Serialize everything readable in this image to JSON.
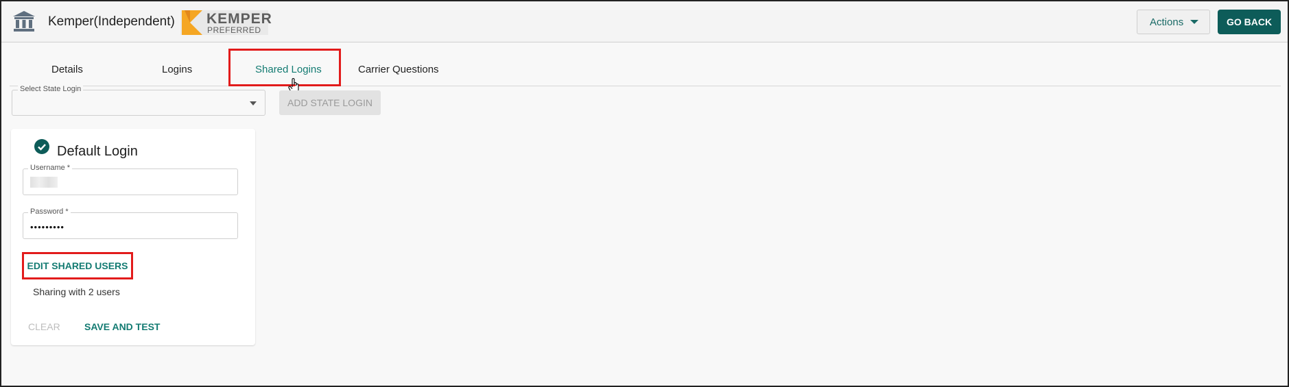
{
  "header": {
    "agency_name": "Kemper(Independent)",
    "logo_line1": "KEMPER",
    "logo_line2": "PREFERRED",
    "actions_label": "Actions",
    "go_back_label": "GO BACK"
  },
  "tabs": [
    {
      "label": "Details"
    },
    {
      "label": "Logins"
    },
    {
      "label": "Shared Logins",
      "active": true
    },
    {
      "label": "Carrier Questions"
    }
  ],
  "state_login": {
    "label": "Select State Login",
    "value": "",
    "add_button_label": "ADD STATE LOGIN"
  },
  "card": {
    "title": "Default Login",
    "username_label": "Username *",
    "username_value": "",
    "password_label": "Password *",
    "password_value": "•••••••••",
    "edit_shared_users_label": "EDIT SHARED USERS",
    "sharing_text": "Sharing with 2 users",
    "clear_label": "CLEAR",
    "save_and_test_label": "SAVE AND TEST"
  },
  "colors": {
    "accent": "#137b72",
    "go_back_bg": "#0d5c59",
    "highlight": "#e21b1b",
    "logo_orange": "#f5a623"
  },
  "icons": [
    "bank-icon",
    "chevron-down-icon",
    "check-circle-icon",
    "hand-cursor-icon"
  ]
}
